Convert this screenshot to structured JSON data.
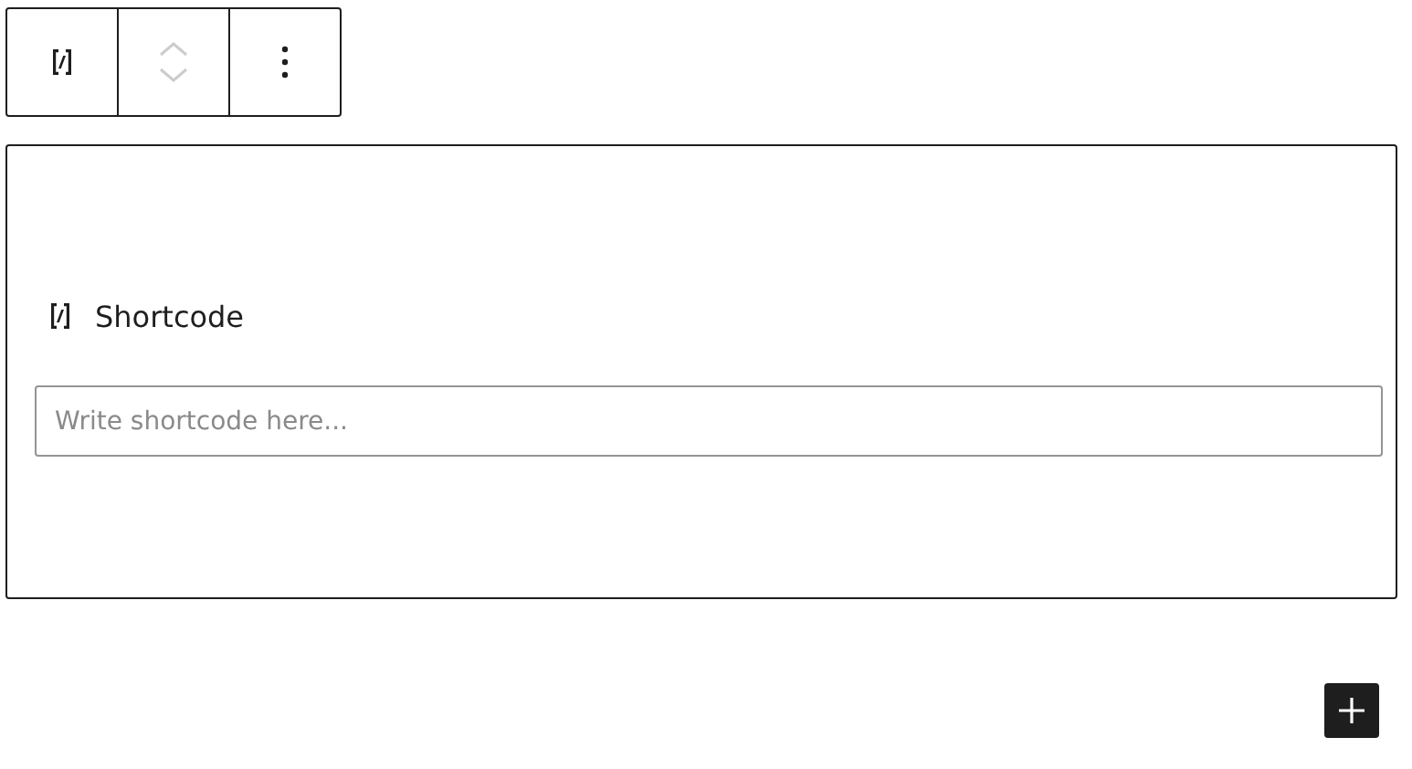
{
  "toolbar": {
    "mover_disabled": true
  },
  "block": {
    "label": "Shortcode",
    "input": {
      "placeholder": "Write shortcode here..."
    }
  }
}
